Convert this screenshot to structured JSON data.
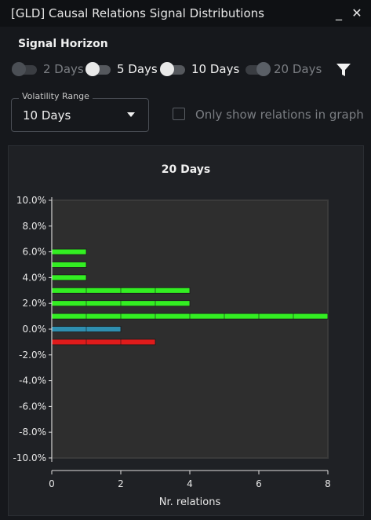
{
  "window": {
    "title": "[GLD] Causal Relations Signal Distributions",
    "minimize_glyph": "_",
    "close_glyph": "✕"
  },
  "signal_horizon": {
    "label": "Signal Horizon",
    "options": [
      {
        "label": "2 Days",
        "state": "off"
      },
      {
        "label": "5 Days",
        "state": "on"
      },
      {
        "label": "10 Days",
        "state": "on"
      },
      {
        "label": "20 Days",
        "state": "selected"
      }
    ],
    "filter_icon": "funnel-icon"
  },
  "volatility": {
    "legend": "Volatility Range",
    "value": "10 Days"
  },
  "only_show_graph": {
    "label": "Only show relations in graph",
    "checked": false
  },
  "colors": {
    "positive": "#33ee22",
    "neutral": "#2f8fb0",
    "negative": "#e01b1b",
    "plot_bg": "#2e2e2e"
  },
  "chart_data": {
    "type": "bar",
    "orientation": "horizontal",
    "title": "20 Days",
    "xlabel": "Nr. relations",
    "ylabel": "",
    "xlim": [
      0,
      8
    ],
    "ylim": [
      -10,
      10
    ],
    "x_ticks": [
      "0",
      "2",
      "4",
      "6",
      "8"
    ],
    "y_ticks": [
      "10.0%",
      "8.0%",
      "6.0%",
      "4.0%",
      "2.0%",
      "0.0%",
      "-2.0%",
      "-4.0%",
      "-6.0%",
      "-8.0%",
      "-10.0%"
    ],
    "bars": [
      {
        "y": 6,
        "value": 1,
        "color": "positive"
      },
      {
        "y": 5,
        "value": 1,
        "color": "positive"
      },
      {
        "y": 4,
        "value": 1,
        "color": "positive"
      },
      {
        "y": 3,
        "value": 4,
        "color": "positive"
      },
      {
        "y": 2,
        "value": 4,
        "color": "positive"
      },
      {
        "y": 1,
        "value": 8,
        "color": "positive"
      },
      {
        "y": 0,
        "value": 2,
        "color": "neutral"
      },
      {
        "y": -1,
        "value": 3,
        "color": "negative"
      }
    ]
  }
}
